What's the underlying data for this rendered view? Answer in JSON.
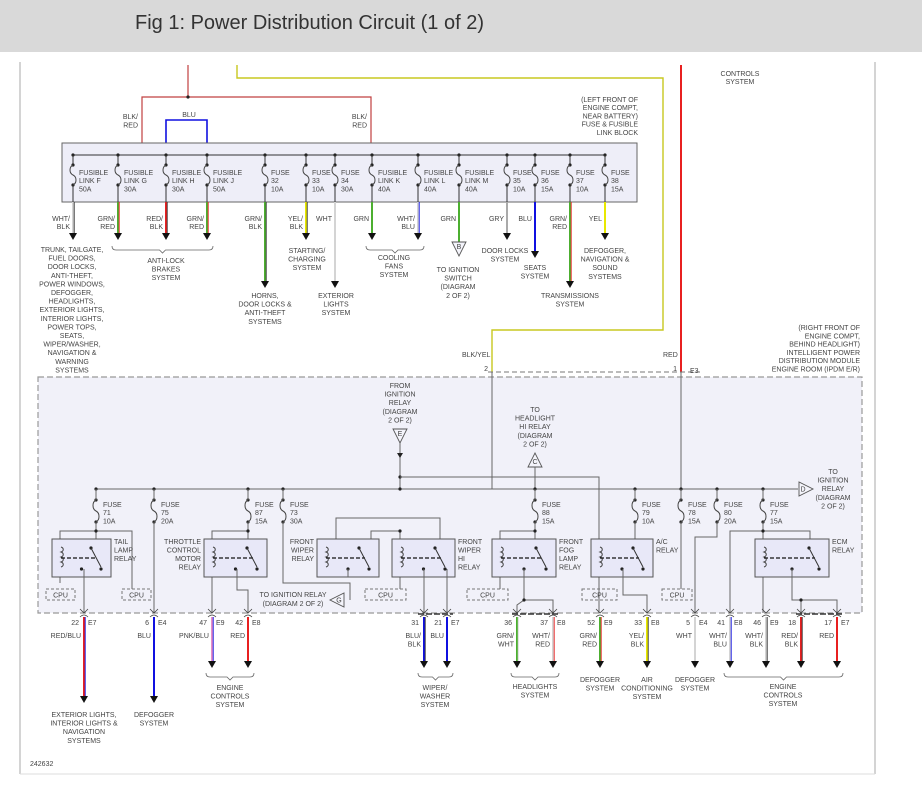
{
  "title": "Fig 1: Power Distribution Circuit (1 of 2)",
  "figure_id": "242632",
  "wire_colors": {
    "WHT": "#d4d4d4",
    "BLK": "#333333",
    "GRN": "#4caf30",
    "RED": "#e82020",
    "BLU": "#1010e0",
    "YEL": "#e8e800",
    "GRY": "#aaaaaa",
    "PNK": "#e890c8"
  },
  "top_right_label": [
    "CONTROLS",
    "SYSTEM"
  ],
  "feed": {
    "left_wire": [
      "BLK/",
      "RED"
    ],
    "jumper_wire": "BLU",
    "right_wire": [
      "BLK/",
      "RED"
    ]
  },
  "fuse_block": {
    "location": [
      "(LEFT FRONT OF",
      "ENGINE COMPT,",
      "NEAR BATTERY)",
      "FUSE & FUSIBLE",
      "LINK BLOCK"
    ],
    "fuses": [
      {
        "label": [
          "FUSIBLE",
          "LINK F",
          "50A"
        ],
        "wire": [
          "WHT/",
          "BLK"
        ]
      },
      {
        "label": [
          "FUSIBLE",
          "LINK G",
          "30A"
        ],
        "wire": [
          "GRN/",
          "RED"
        ]
      },
      {
        "label": [
          "FUSIBLE",
          "LINK H",
          "30A"
        ],
        "wire": [
          "RED/",
          "BLK"
        ]
      },
      {
        "label": [
          "FUSIBLE",
          "LINK J",
          "50A"
        ],
        "wire": [
          "GRN/",
          "RED"
        ]
      },
      {
        "label": [
          "FUSE",
          "32",
          "10A"
        ],
        "wire": [
          "GRN/",
          "BLK"
        ]
      },
      {
        "label": [
          "FUSE",
          "33",
          "10A"
        ],
        "wire": [
          "YEL/",
          "BLK"
        ]
      },
      {
        "label": [
          "FUSE",
          "34",
          "30A"
        ],
        "wire": [
          "WHT"
        ]
      },
      {
        "label": [
          "FUSIBLE",
          "LINK K",
          "40A"
        ],
        "wire": [
          "GRN"
        ]
      },
      {
        "label": [
          "FUSIBLE",
          "LINK L",
          "40A"
        ],
        "wire": [
          "WHT/",
          "BLU"
        ]
      },
      {
        "label": [
          "FUSIBLE",
          "LINK M",
          "40A"
        ],
        "wire": [
          "GRN"
        ]
      },
      {
        "label": [
          "FUSE",
          "35",
          "10A"
        ],
        "wire": [
          "GRY"
        ]
      },
      {
        "label": [
          "FUSE",
          "36",
          "15A"
        ],
        "wire": [
          "BLU"
        ]
      },
      {
        "label": [
          "FUSE",
          "37",
          "10A"
        ],
        "wire": [
          "GRN/",
          "RED"
        ]
      },
      {
        "label": [
          "FUSE",
          "38",
          "15A"
        ],
        "wire": [
          "YEL"
        ]
      }
    ],
    "destinations": [
      [
        "TRUNK, TAILGATE,",
        "FUEL DOORS,",
        "DOOR LOCKS,",
        "ANTI-THEFT,",
        "POWER WINDOWS,",
        "DEFOGGER,",
        "HEADLIGHTS,",
        "EXTERIOR LIGHTS,",
        "INTERIOR LIGHTS,",
        "POWER TOPS,",
        "SEATS,",
        "WIPER/WASHER,",
        "NAVIGATION &",
        "WARNING",
        "SYSTEMS"
      ],
      [
        "ANTI-LOCK",
        "BRAKES",
        "SYSTEM"
      ],
      [
        "HORNS,",
        "DOOR LOCKS &",
        "ANTI-THEFT",
        "SYSTEMS"
      ],
      [
        "STARTING/",
        "CHARGING",
        "SYSTEM"
      ],
      [
        "EXTERIOR",
        "LIGHTS",
        "SYSTEM"
      ],
      [
        "COOLING",
        "FANS",
        "SYSTEM"
      ],
      [
        "TO IGNITION",
        "SWITCH",
        "(DIAGRAM",
        "2 OF 2)"
      ],
      [
        "DOOR LOCKS",
        "SYSTEM"
      ],
      [
        "SEATS",
        "SYSTEM"
      ],
      [
        "TRANSMISSIONS",
        "SYSTEM"
      ],
      [
        "DEFOGGER,",
        "NAVIGATION &",
        "SOUND",
        "SYSTEMS"
      ]
    ],
    "connector_b": "B"
  },
  "ipdm": {
    "location": [
      "(RIGHT FRONT OF",
      "ENGINE COMPT,",
      "BEHIND HEADLIGHT)",
      "INTELLIGENT POWER",
      "DISTRIBUTION MODULE",
      "ENGINE ROOM (IPDM E/R)"
    ],
    "inputs": [
      {
        "wire": "BLK/YEL",
        "pin": "2",
        "connector": ""
      },
      {
        "wire": "RED",
        "pin": "1",
        "connector": "E3"
      }
    ],
    "fuses": [
      [
        "FUSE",
        "71",
        "10A"
      ],
      [
        "FUSE",
        "75",
        "20A"
      ],
      [
        "FUSE",
        "87",
        "15A"
      ],
      [
        "FUSE",
        "73",
        "30A"
      ],
      [
        "FUSE",
        "88",
        "15A"
      ],
      [
        "FUSE",
        "79",
        "10A"
      ],
      [
        "FUSE",
        "78",
        "15A"
      ],
      [
        "FUSE",
        "80",
        "20A"
      ],
      [
        "FUSE",
        "77",
        "15A"
      ]
    ],
    "relays": [
      [
        "TAIL",
        "LAMP",
        "RELAY"
      ],
      [
        "THROTTLE",
        "CONTROL",
        "MOTOR",
        "RELAY"
      ],
      [
        "FRONT",
        "WIPER",
        "RELAY"
      ],
      [
        "FRONT",
        "WIPER",
        "HI",
        "RELAY"
      ],
      [
        "FRONT",
        "FOG",
        "LAMP",
        "RELAY"
      ],
      [
        "A/C",
        "RELAY"
      ],
      [
        "ECM",
        "RELAY"
      ]
    ],
    "cpu_label": "CPU",
    "references": [
      {
        "letter": "E",
        "text": [
          "FROM",
          "IGNITION",
          "RELAY",
          "(DIAGRAM",
          "2 OF 2)"
        ]
      },
      {
        "letter": "C",
        "text": [
          "TO",
          "HEADLIGHT",
          "HI RELAY",
          "(DIAGRAM",
          "2 OF 2)"
        ]
      },
      {
        "letter": "D",
        "text": [
          "TO",
          "IGNITION",
          "RELAY",
          "(DIAGRAM",
          "2 OF 2)"
        ]
      },
      {
        "letter": "G",
        "text": [
          "TO IGNITION RELAY",
          "(DIAGRAM 2 OF 2)"
        ]
      }
    ],
    "outputs": [
      {
        "pin": "22",
        "connector": "E7",
        "wire": [
          "RED/BLU"
        ]
      },
      {
        "pin": "6",
        "connector": "E4",
        "wire": [
          "BLU"
        ]
      },
      {
        "pin": "47",
        "connector": "E9",
        "wire": [
          "PNK/BLU"
        ]
      },
      {
        "pin": "42",
        "connector": "E8",
        "wire": [
          "RED"
        ]
      },
      {
        "pin": "31",
        "connector": "",
        "wire": [
          "BLU/",
          "BLK"
        ]
      },
      {
        "pin": "21",
        "connector": "E7",
        "wire": [
          "BLU"
        ]
      },
      {
        "pin": "36",
        "connector": "",
        "wire": [
          "GRN/",
          "WHT"
        ]
      },
      {
        "pin": "37",
        "connector": "E8",
        "wire": [
          "WHT/",
          "RED"
        ]
      },
      {
        "pin": "52",
        "connector": "E9",
        "wire": [
          "GRN/",
          "RED"
        ]
      },
      {
        "pin": "33",
        "connector": "E8",
        "wire": [
          "YEL/",
          "BLK"
        ]
      },
      {
        "pin": "5",
        "connector": "E4",
        "wire": [
          "WHT"
        ]
      },
      {
        "pin": "41",
        "connector": "E8",
        "wire": [
          "WHT/",
          "BLU"
        ]
      },
      {
        "pin": "46",
        "connector": "E9",
        "wire": [
          "WHT/",
          "BLK"
        ]
      },
      {
        "pin": "18",
        "connector": "",
        "wire": [
          "RED/",
          "BLK"
        ]
      },
      {
        "pin": "17",
        "connector": "E7",
        "wire": [
          "RED"
        ]
      }
    ],
    "destinations": [
      [
        "EXTERIOR LIGHTS,",
        "INTERIOR LIGHTS &",
        "NAVIGATION",
        "SYSTEMS"
      ],
      [
        "DEFOGGER",
        "SYSTEM"
      ],
      [
        "ENGINE",
        "CONTROLS",
        "SYSTEM"
      ],
      [
        "WIPER/",
        "WASHER",
        "SYSTEM"
      ],
      [
        "HEADLIGHTS",
        "SYSTEM"
      ],
      [
        "DEFOGGER",
        "SYSTEM"
      ],
      [
        "AIR",
        "CONDITIONING",
        "SYSTEM"
      ],
      [
        "DEFOGGER",
        "SYSTEM"
      ],
      [
        "ENGINE",
        "CONTROLS",
        "SYSTEM"
      ]
    ]
  }
}
